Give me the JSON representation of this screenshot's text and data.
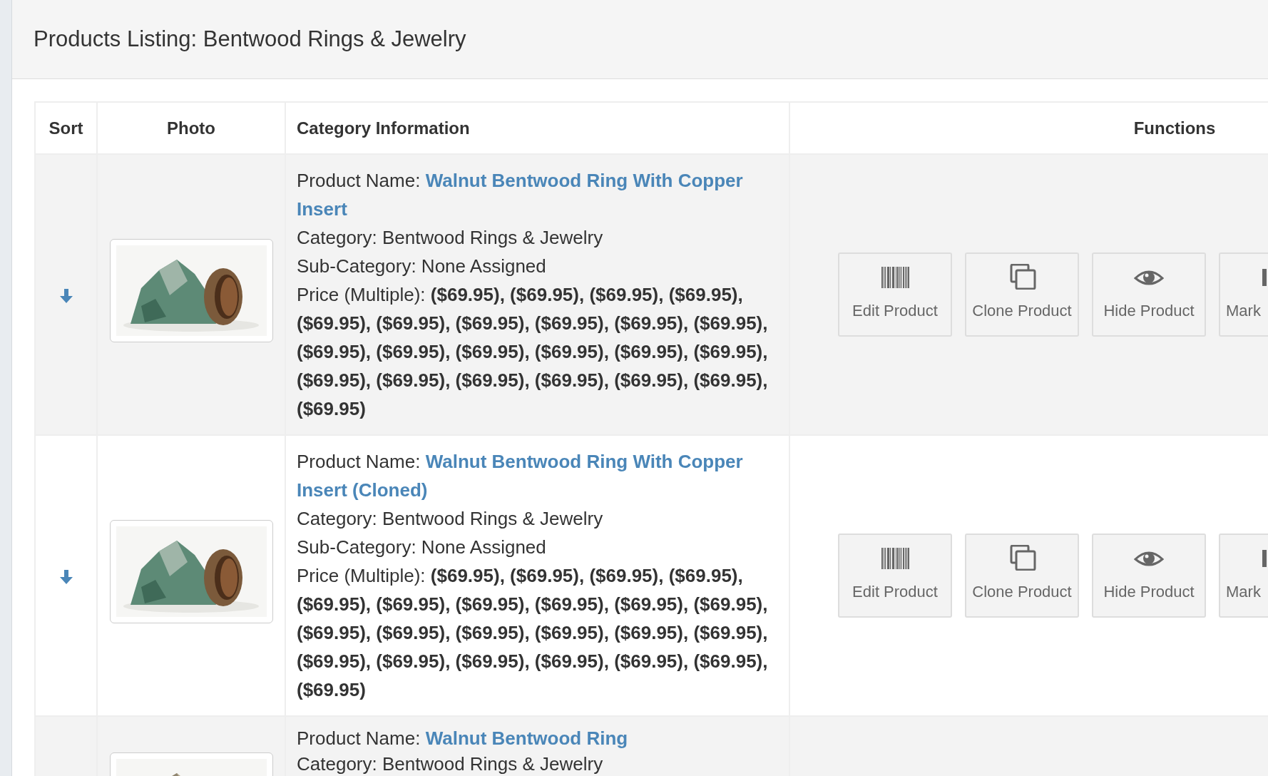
{
  "title": "Products Listing: Bentwood Rings & Jewelry",
  "columns": [
    "Sort",
    "Photo",
    "Category Information",
    "Functions"
  ],
  "rows": [
    {
      "name_label": "Product Name:",
      "name": "Walnut Bentwood Ring With Copper Insert",
      "category": "Category: Bentwood Rings & Jewelry",
      "subcategory": "Sub-Category: None Assigned",
      "price": "Price (Multiple): **($69.95), ($69.95), ($69.95), ($69.95), ($69.95), ($69.95), ($69.95), ($69.95), ($69.95), ($69.95), ($69.95), ($69.95), ($69.95), ($69.95), ($69.95), ($69.95), ($69.95), ($69.95), ($69.95), ($69.95), ($69.95), ($69.95), ($69.95)**",
      "buttons": [
        {
          "kind": "edit",
          "label": "Edit Product"
        },
        {
          "kind": "clone",
          "label": "Clone Product"
        },
        {
          "kind": "hide",
          "label": "Hide Product"
        },
        {
          "kind": "mark",
          "label": "Mark"
        }
      ]
    },
    {
      "name_label": "Product Name:",
      "name": "Walnut Bentwood Ring With Copper Insert (Cloned)",
      "category": "Category: Bentwood Rings & Jewelry",
      "subcategory": "Sub-Category: None Assigned",
      "price": "Price (Multiple): **($69.95), ($69.95), ($69.95), ($69.95), ($69.95), ($69.95), ($69.95), ($69.95), ($69.95), ($69.95), ($69.95), ($69.95), ($69.95), ($69.95), ($69.95), ($69.95), ($69.95), ($69.95), ($69.95), ($69.95), ($69.95), ($69.95), ($69.95)**",
      "buttons": [
        {
          "kind": "edit",
          "label": "Edit Product"
        },
        {
          "kind": "clone",
          "label": "Clone Product"
        },
        {
          "kind": "hide",
          "label": "Hide Product"
        },
        {
          "kind": "mark",
          "label": "Mark"
        }
      ]
    },
    {
      "name_label": "Product Name:",
      "name": "Walnut Bentwood Ring",
      "category": "Category: Bentwood Rings & Jewelry"
    }
  ]
}
